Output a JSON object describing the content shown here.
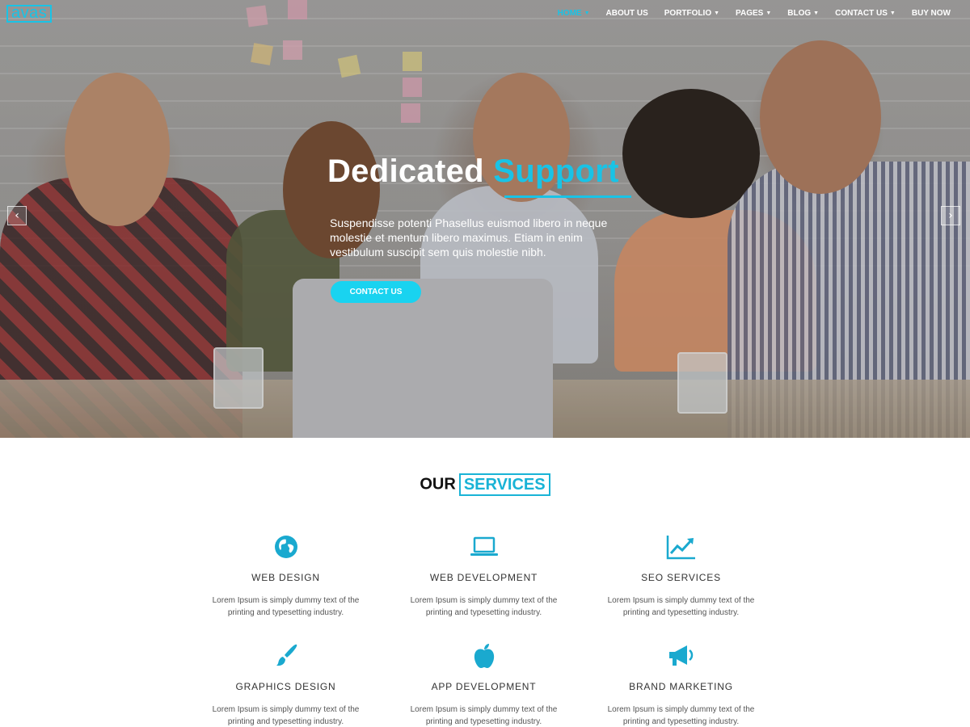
{
  "brand": {
    "logo_text": "avas",
    "accent": "#19c3e6"
  },
  "nav": {
    "items": [
      {
        "label": "HOME",
        "active": true,
        "has_dropdown": true
      },
      {
        "label": "ABOUT US",
        "active": false,
        "has_dropdown": false
      },
      {
        "label": "PORTFOLIO",
        "active": false,
        "has_dropdown": true
      },
      {
        "label": "PAGES",
        "active": false,
        "has_dropdown": true
      },
      {
        "label": "BLOG",
        "active": false,
        "has_dropdown": true
      },
      {
        "label": "CONTACT US",
        "active": false,
        "has_dropdown": true
      },
      {
        "label": "BUY NOW",
        "active": false,
        "has_dropdown": false
      }
    ]
  },
  "hero": {
    "title_plain": "Dedicated",
    "title_accent": "Support",
    "text": "Suspendisse potenti Phasellus euismod libero in neque molestie et mentum libero maximus. Etiam in enim vestibulum suscipit sem quis molestie nibh.",
    "button_label": "CONTACT US",
    "prev_icon": "chevron-left-icon",
    "next_icon": "chevron-right-icon"
  },
  "services": {
    "heading_plain": "OUR",
    "heading_boxed": "SERVICES",
    "items": [
      {
        "icon": "globe-icon",
        "title": "WEB DESIGN",
        "desc": "Lorem Ipsum is simply dummy text of the printing and typesetting industry."
      },
      {
        "icon": "laptop-icon",
        "title": "WEB DEVELOPMENT",
        "desc": "Lorem Ipsum is simply dummy text of the printing and typesetting industry."
      },
      {
        "icon": "line-chart-icon",
        "title": "SEO SERVICES",
        "desc": "Lorem Ipsum is simply dummy text of the printing and typesetting industry."
      },
      {
        "icon": "brush-icon",
        "title": "GRAPHICS DESIGN",
        "desc": "Lorem Ipsum is simply dummy text of the printing and typesetting industry."
      },
      {
        "icon": "apple-icon",
        "title": "APP DEVELOPMENT",
        "desc": "Lorem Ipsum is simply dummy text of the printing and typesetting industry."
      },
      {
        "icon": "megaphone-icon",
        "title": "BRAND MARKETING",
        "desc": "Lorem Ipsum is simply dummy text of the printing and typesetting industry."
      }
    ]
  }
}
